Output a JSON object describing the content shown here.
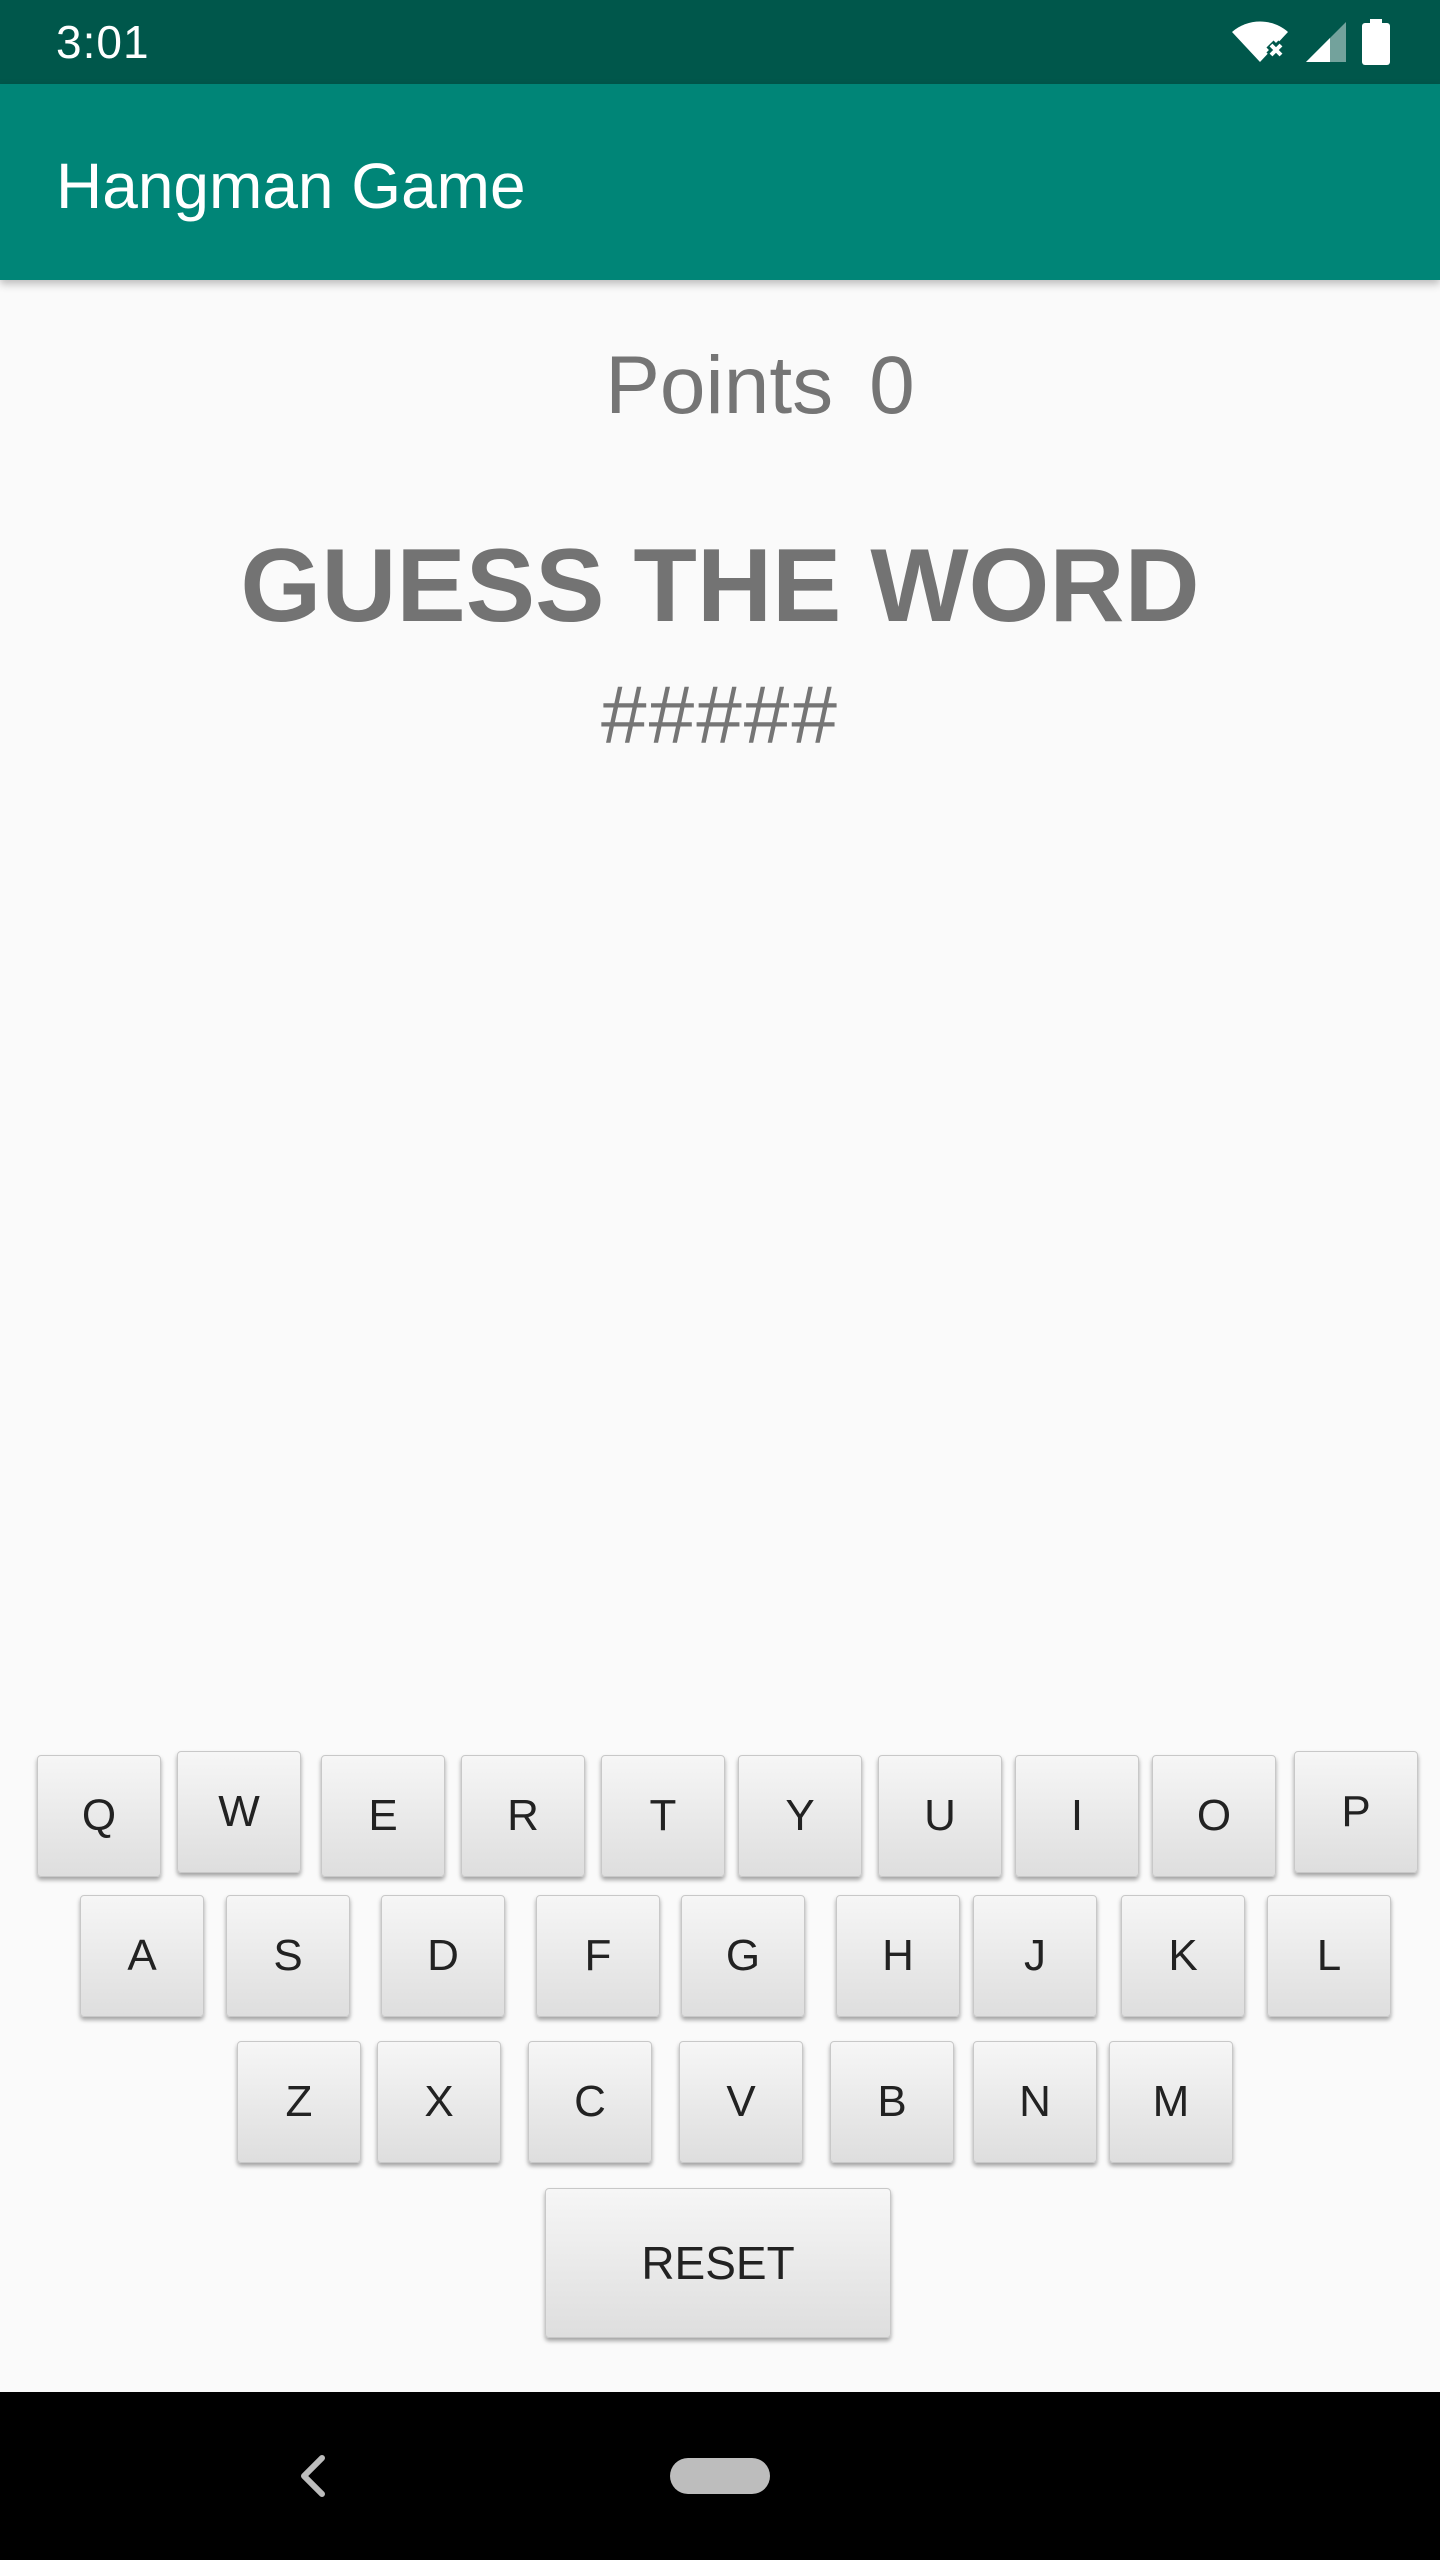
{
  "status_bar": {
    "time": "3:01",
    "icons": [
      "wifi-icon",
      "signal-icon",
      "battery-icon"
    ]
  },
  "app_bar": {
    "title": "Hangman Game"
  },
  "score": {
    "label": "Points",
    "value": "0"
  },
  "game": {
    "title": "GUESS THE WORD",
    "masked_word": "#####"
  },
  "keyboard": {
    "row1": [
      "Q",
      "W",
      "E",
      "R",
      "T",
      "Y",
      "U",
      "I",
      "O",
      "P"
    ],
    "row2": [
      "A",
      "S",
      "D",
      "F",
      "G",
      "H",
      "J",
      "K",
      "L"
    ],
    "row3": [
      "Z",
      "X",
      "C",
      "V",
      "B",
      "N",
      "M"
    ],
    "reset_label": "RESET"
  },
  "nav_bar": {
    "icons": [
      "back-icon",
      "home-icon"
    ]
  },
  "colors": {
    "status_bar": "#00574b",
    "app_bar": "#008577",
    "background": "#fafafa",
    "text_gray": "#757575"
  }
}
